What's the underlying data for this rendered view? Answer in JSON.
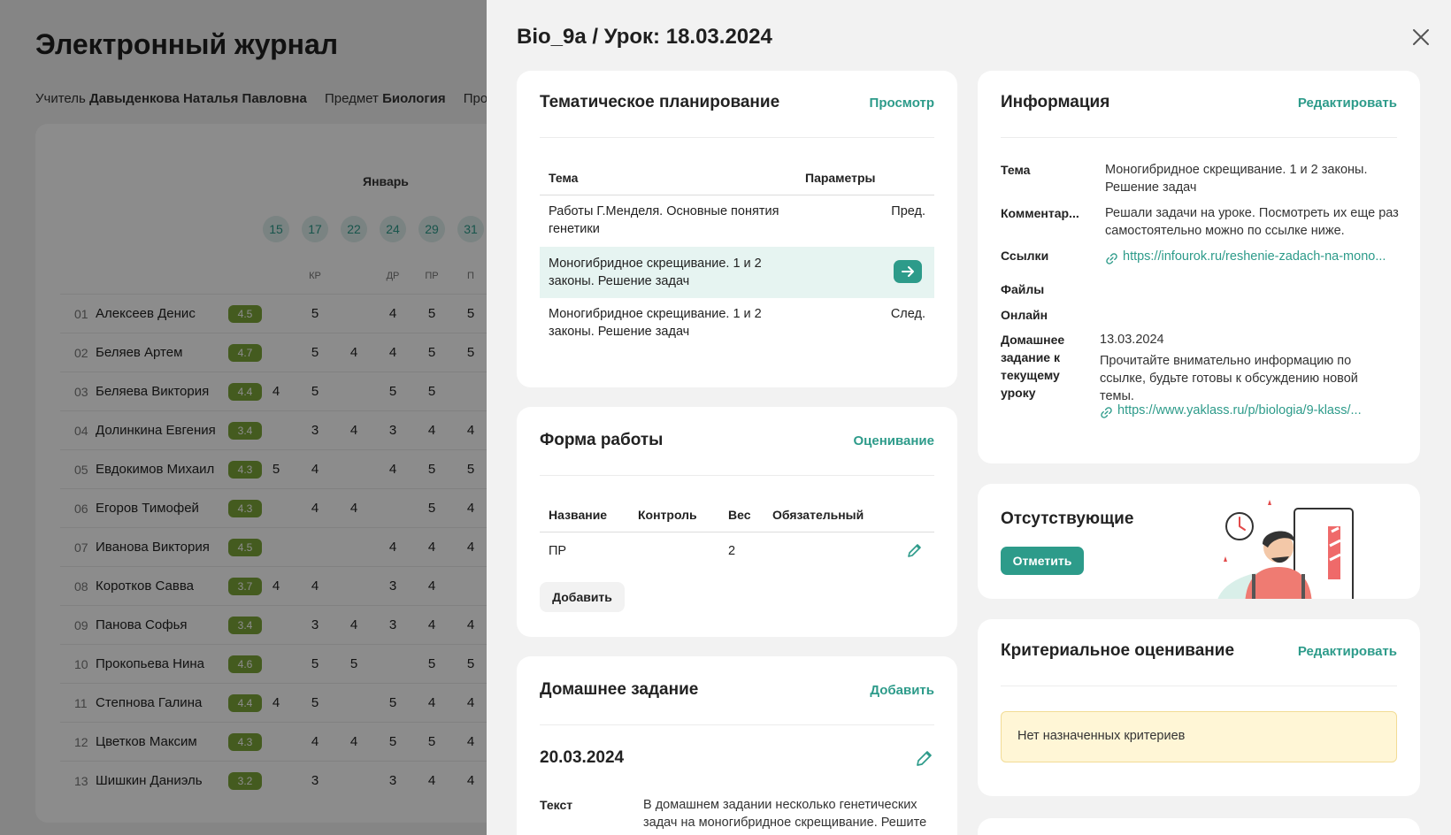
{
  "background": {
    "title": "Электронный журнал",
    "teacher_label": "Учитель",
    "teacher": "Давыденкова Наталья Павловна",
    "subject_label": "Предмет",
    "subject": "Биология",
    "program_label": "Програ",
    "month": "Январь",
    "days": [
      "15",
      "17",
      "22",
      "24",
      "29",
      "31"
    ],
    "day_types": [
      "",
      "КР",
      "",
      "ДР",
      "ПР",
      "П"
    ],
    "students": [
      {
        "num": "01",
        "name": "Алексеев Денис",
        "avg": "4.5",
        "grades": [
          "",
          "5",
          "",
          "4",
          "5",
          "5"
        ]
      },
      {
        "num": "02",
        "name": "Беляев Артем",
        "avg": "4.7",
        "grades": [
          "",
          "5",
          "4",
          "4",
          "5",
          "5"
        ]
      },
      {
        "num": "03",
        "name": "Беляева Виктория",
        "avg": "4.4",
        "grades": [
          "4",
          "5",
          "",
          "5",
          "5",
          ""
        ]
      },
      {
        "num": "04",
        "name": "Долинкина Евгения",
        "avg": "3.4",
        "grades": [
          "",
          "3",
          "4",
          "3",
          "4",
          "4"
        ]
      },
      {
        "num": "05",
        "name": "Евдокимов Михаил",
        "avg": "4.3",
        "grades": [
          "5",
          "4",
          "",
          "4",
          "5",
          "5"
        ]
      },
      {
        "num": "06",
        "name": "Егоров Тимофей",
        "avg": "4.3",
        "grades": [
          "",
          "4",
          "4",
          "",
          "5",
          "4"
        ]
      },
      {
        "num": "07",
        "name": "Иванова Виктория",
        "avg": "4.5",
        "grades": [
          "",
          "",
          "",
          "4",
          "4",
          "4"
        ]
      },
      {
        "num": "08",
        "name": "Коротков Савва",
        "avg": "3.7",
        "grades": [
          "4",
          "4",
          "",
          "3",
          "4",
          ""
        ]
      },
      {
        "num": "09",
        "name": "Панова Софья",
        "avg": "3.4",
        "grades": [
          "",
          "3",
          "4",
          "3",
          "4",
          "4"
        ]
      },
      {
        "num": "10",
        "name": "Прокопьева Нина",
        "avg": "4.6",
        "grades": [
          "",
          "5",
          "5",
          "",
          "5",
          "5"
        ]
      },
      {
        "num": "11",
        "name": "Степнова Галина",
        "avg": "4.4",
        "grades": [
          "4",
          "5",
          "",
          "5",
          "4",
          "4"
        ]
      },
      {
        "num": "12",
        "name": "Цветков Максим",
        "avg": "4.3",
        "grades": [
          "",
          "4",
          "4",
          "5",
          "5",
          "4"
        ]
      },
      {
        "num": "13",
        "name": "Шишкин Даниэль",
        "avg": "3.2",
        "grades": [
          "",
          "3",
          "",
          "3",
          "4",
          "4"
        ]
      }
    ]
  },
  "drawer": {
    "title": "Bio_9a / Урок: 18.03.2024",
    "planning": {
      "title": "Тематическое планирование",
      "action": "Просмотр",
      "col_topic": "Тема",
      "col_params": "Параметры",
      "rows": [
        {
          "topic": "Работы Г.Менделя. Основные понятия генетики",
          "param": "Пред."
        },
        {
          "topic": "Моногибридное скрещивание. 1 и 2 законы. Решение задач",
          "param": ""
        },
        {
          "topic": "Моногибридное скрещивание. 1 и 2 законы. Решение задач",
          "param": "След."
        }
      ]
    },
    "work_form": {
      "title": "Форма работы",
      "action": "Оценивание",
      "cols": [
        "Название",
        "Контроль",
        "Вес",
        "Обязательный"
      ],
      "row": {
        "name": "ПР",
        "control": "",
        "weight": "2",
        "required": ""
      },
      "add": "Добавить"
    },
    "homework": {
      "title": "Домашнее задание",
      "action": "Добавить",
      "date": "20.03.2024",
      "text_label": "Текст",
      "text": "В домашнем задании несколько генетических задач на моногибридное скрещивание. Решите"
    },
    "info": {
      "title": "Информация",
      "action": "Редактировать",
      "topic_label": "Тема",
      "topic": "Моногибридное скрещивание. 1 и 2 законы. Решение задач",
      "comment_label": "Комментар...",
      "comment": "Решали задачи на уроке. Посмотреть их еще раз самостоятельно можно по ссылке ниже.",
      "links_label": "Ссылки",
      "link": "https://infourok.ru/reshenie-zadach-na-mono...",
      "files_label": "Файлы",
      "online_label": "Онлайн",
      "hw_label": "Домашнее задание к текущему уроку",
      "hw_date": "13.03.2024",
      "hw_text": "Прочитайте внимательно информацию по ссылке, будьте готовы к обсуждению новой темы.",
      "hw_link": "https://www.yaklass.ru/p/biologia/9-klass/..."
    },
    "absent": {
      "title": "Отсутствующие",
      "button": "Отметить"
    },
    "criteria": {
      "title": "Критериальное оценивание",
      "action": "Редактировать",
      "empty": "Нет назначенных критериев"
    },
    "colors": {
      "accent": "#2d9b8a",
      "avg_badge": "#7da63a",
      "notice_bg": "#fff6d6"
    }
  }
}
